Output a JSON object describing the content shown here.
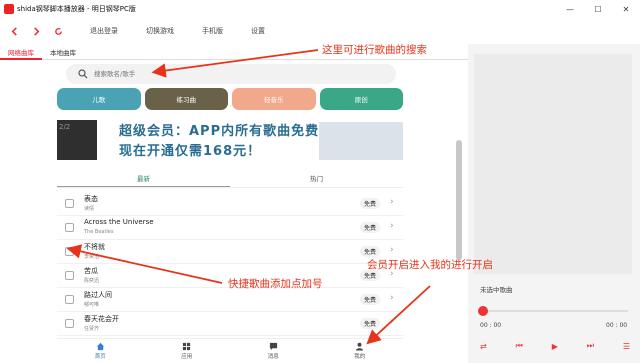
{
  "window": {
    "title": "shida钢琴脚本播放器 - 明日钢琴PC版",
    "minimize": "—",
    "maximize": "☐",
    "close": "✕"
  },
  "toolbar": {
    "menu": [
      "退出登录",
      "切换游戏",
      "手机版",
      "设置"
    ]
  },
  "tabs": [
    "网络曲库",
    "本地曲库"
  ],
  "search": {
    "placeholder": "搜索歌名/歌手"
  },
  "categories": [
    {
      "label": "儿歌",
      "color": "#4aa3b4"
    },
    {
      "label": "练习曲",
      "color": "#6a6248"
    },
    {
      "label": "轻音乐",
      "color": "#f2a88a"
    },
    {
      "label": "原创",
      "color": "#3aa887"
    }
  ],
  "banner": {
    "thumb_text": "2/2",
    "line1": "超级会员：APP内所有歌曲免费",
    "line2": "现在开通仅需168元！"
  },
  "subtabs": [
    "最新",
    "热门"
  ],
  "songs": [
    {
      "name": "表态",
      "artist": "读情",
      "badge": "免费"
    },
    {
      "name": "Across the Universe",
      "artist": "The Beatles",
      "badge": "免费"
    },
    {
      "name": "不将就",
      "artist": "李荣浩",
      "badge": "免费"
    },
    {
      "name": "苦瓜",
      "artist": "陈奕迅",
      "badge": "免费"
    },
    {
      "name": "路过人间",
      "artist": "郁可唯",
      "badge": "免费"
    },
    {
      "name": "春天花会开",
      "artist": "任贤齐",
      "badge": "免费"
    }
  ],
  "bottomnav": [
    {
      "label": "首页",
      "icon": "home-icon"
    },
    {
      "label": "应用",
      "icon": "apps-icon"
    },
    {
      "label": "消息",
      "icon": "message-icon"
    },
    {
      "label": "我的",
      "icon": "user-icon"
    }
  ],
  "player": {
    "no_song": "未选中歌曲",
    "time_current": "00 : 00",
    "time_total": "00 : 00",
    "progress": 0
  },
  "annotations": {
    "search_note": "这里可进行歌曲的搜索",
    "member_note": "会员开启进入我的进行开启",
    "add_note": "快捷歌曲添加点加号"
  },
  "colors": {
    "accent": "#e23333",
    "annotation": "#e8331a",
    "banner_text": "#2a6d93"
  }
}
